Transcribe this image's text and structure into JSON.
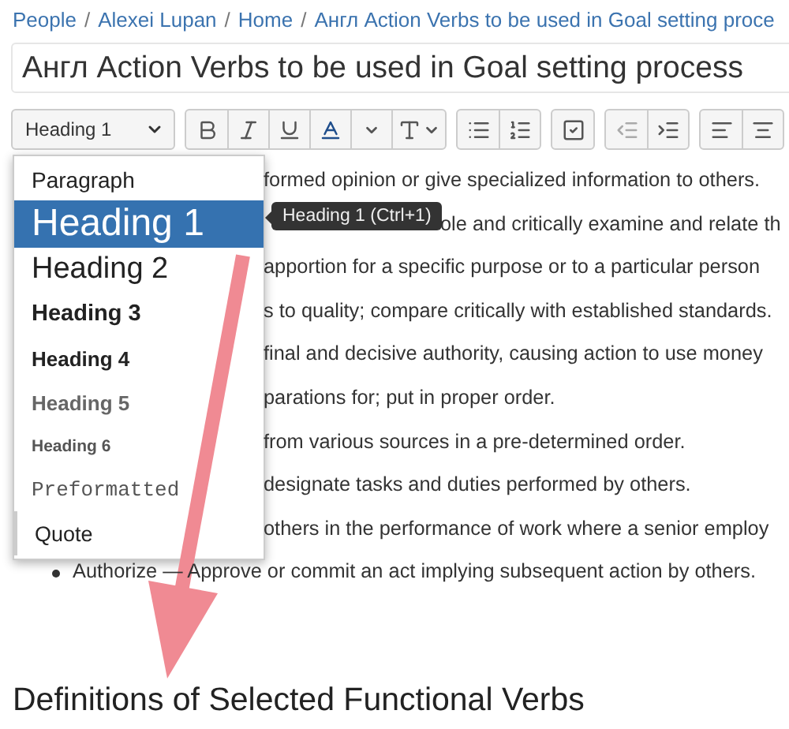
{
  "breadcrumbs": [
    {
      "label": "People"
    },
    {
      "separator": "/",
      "label": "Alexei Lupan"
    },
    {
      "separator": "/",
      "label": "Home"
    },
    {
      "separator": "/",
      "label": "Англ Action Verbs to be used in Goal setting proce"
    }
  ],
  "title_field": {
    "value": "Англ Action Verbs to be used in Goal setting process"
  },
  "toolbar": {
    "style_select": "Heading 1"
  },
  "style_menu": [
    {
      "label": "Paragraph",
      "kind": "paragraph",
      "selected": false
    },
    {
      "label": "Heading 1",
      "kind": "h1",
      "selected": true
    },
    {
      "label": "Heading 2",
      "kind": "h2",
      "selected": false
    },
    {
      "label": "Heading 3",
      "kind": "h3",
      "selected": false
    },
    {
      "label": "Heading 4",
      "kind": "h4",
      "selected": false
    },
    {
      "label": "Heading 5",
      "kind": "h5",
      "selected": false
    },
    {
      "label": "Heading 6",
      "kind": "h6",
      "selected": false
    },
    {
      "label": "Preformatted",
      "kind": "pre",
      "selected": false
    },
    {
      "label": "Quote",
      "kind": "quote",
      "selected": false
    }
  ],
  "tooltip": "Heading 1 (Ctrl+1)",
  "body_lines": [
    {
      "text": "formed opinion or give specialized information to others.",
      "kind": "covered"
    },
    {
      "text": "ole and critically examine and relate th",
      "kind": "covered_tip"
    },
    {
      "text": "apportion for a specific purpose or to a particular person",
      "kind": "covered"
    },
    {
      "text": "s to quality; compare critically with established standards.",
      "kind": "covered"
    },
    {
      "text": "final and decisive authority, causing action to use money",
      "kind": "covered"
    },
    {
      "text": "parations for; put in proper order.",
      "kind": "covered"
    },
    {
      "text": "from various sources in a pre-determined order.",
      "kind": "covered"
    },
    {
      "text": "designate tasks and duties performed by others.",
      "kind": "covered"
    },
    {
      "text": "others in the performance of work where a senior employ",
      "kind": "covered"
    },
    {
      "text": "Authorize — Approve or commit an act implying subsequent action by others.",
      "kind": "bullet"
    }
  ],
  "heading": "Definitions of Selected Functional Verbs"
}
